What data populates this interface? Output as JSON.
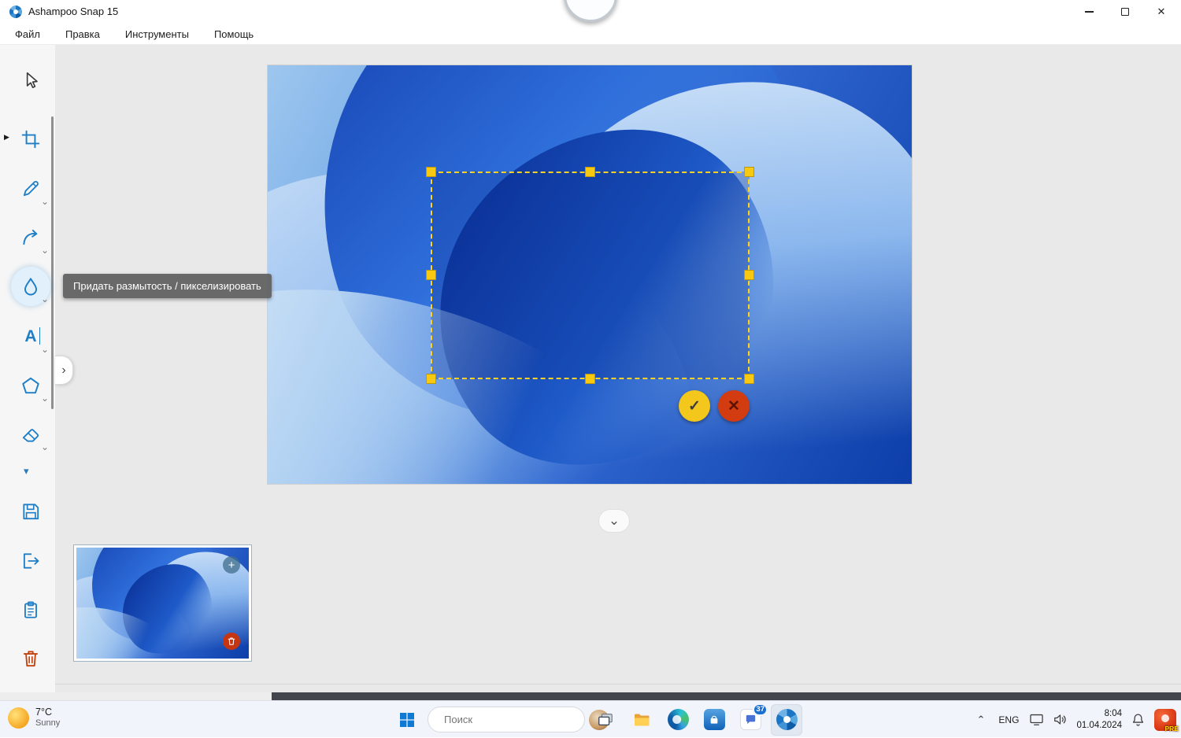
{
  "window": {
    "title": "Ashampoo Snap 15"
  },
  "menu": {
    "items": [
      {
        "label": "Файл"
      },
      {
        "label": "Правка"
      },
      {
        "label": "Инструменты"
      },
      {
        "label": "Помощь"
      }
    ]
  },
  "sidebar": {
    "tools": [
      {
        "id": "select",
        "icon": "cursor-icon"
      },
      {
        "id": "crop",
        "icon": "crop-icon"
      },
      {
        "id": "pen",
        "icon": "pencil-icon",
        "has_menu": true
      },
      {
        "id": "arrow",
        "icon": "curved-arrow-icon",
        "has_menu": true
      },
      {
        "id": "blur",
        "icon": "droplet-icon",
        "has_menu": true,
        "active": true
      },
      {
        "id": "text",
        "icon": "text-icon",
        "has_menu": true
      },
      {
        "id": "shape",
        "icon": "polygon-icon",
        "has_menu": true
      },
      {
        "id": "eraser",
        "icon": "eraser-icon",
        "has_menu": true
      },
      {
        "id": "save",
        "icon": "save-icon"
      },
      {
        "id": "export",
        "icon": "export-icon"
      },
      {
        "id": "clipboard",
        "icon": "clipboard-icon"
      },
      {
        "id": "delete",
        "icon": "trash-icon"
      }
    ]
  },
  "tooltip": {
    "text": "Придать размытость / пикселизировать"
  },
  "icons": {
    "close": "✕",
    "chevron_down": "⌄",
    "chevron_up": "⌃",
    "expand_right": "›",
    "more_tools": "▾",
    "tool_marker": "▶",
    "plus": "+",
    "check": "✓",
    "cross": "✕",
    "text_tool": "A"
  },
  "colors": {
    "accent_blue": "#1f7ec6",
    "selection_yellow": "#f8c912",
    "confirm_yellow": "#f3c71b",
    "cancel_red": "#d23c10"
  },
  "taskbar": {
    "weather": {
      "temp": "7°C",
      "condition": "Sunny"
    },
    "search": {
      "placeholder": "Поиск"
    },
    "chat_badge": "37",
    "tray": {
      "language": "ENG",
      "time": "8:04",
      "date": "01.04.2024",
      "pre_badge": "PRE"
    }
  }
}
